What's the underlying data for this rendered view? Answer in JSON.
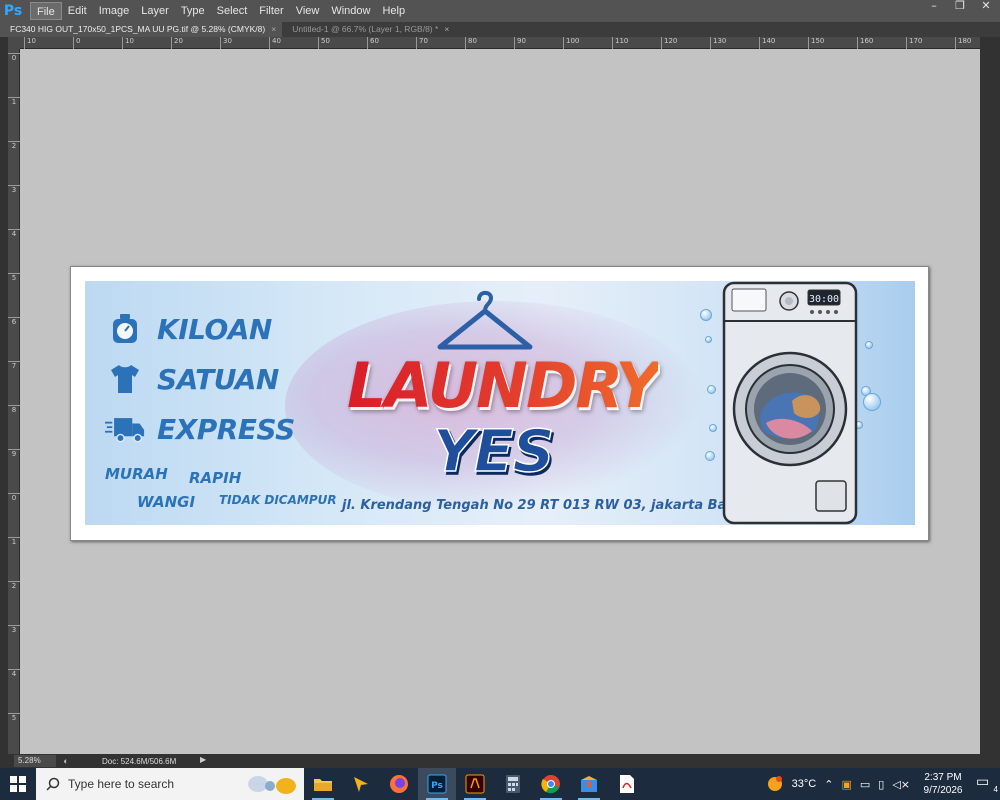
{
  "app": {
    "logo": "Ps"
  },
  "menu": [
    "File",
    "Edit",
    "Image",
    "Layer",
    "Type",
    "Select",
    "Filter",
    "View",
    "Window",
    "Help"
  ],
  "window_controls": [
    "–",
    "❐",
    "✕"
  ],
  "tabs": [
    {
      "label": "FC340 HIG OUT_170x50_1PCS_MA UU PG.tif @ 5.28% (CMYK/8)",
      "close": "×"
    },
    {
      "label": "Untitled-1 @ 66.7% (Layer 1, RGB/8) *",
      "close": "×"
    }
  ],
  "ruler_h": [
    "10",
    "0",
    "10",
    "20",
    "30",
    "40",
    "50",
    "60",
    "70",
    "80",
    "90",
    "100",
    "110",
    "120",
    "130",
    "140",
    "150",
    "160",
    "170",
    "180"
  ],
  "ruler_v": [
    "0",
    "1",
    "2",
    "3",
    "4",
    "5",
    "6",
    "7",
    "8",
    "9",
    "0",
    "1",
    "2",
    "3",
    "4",
    "5"
  ],
  "banner": {
    "services": [
      "KILOAN",
      "SATUAN",
      "EXPRESS"
    ],
    "tags": [
      "MURAH",
      "RAPIH",
      "WANGI",
      "TIDAK DICAMPUR"
    ],
    "title_line1": "LAUNDRY",
    "title_line2": "YES",
    "address": "jl. Krendang Tengah No 29 RT 013 RW 03, jakarta Barat",
    "washer_display": "30:00",
    "colors": {
      "title_red": "#d81e2a",
      "title_orange": "#ef6b2c",
      "title_blue": "#1f4e9a",
      "service_blue": "#2c72b8"
    }
  },
  "status": {
    "zoom": "5.28%",
    "doc": "Doc: 524.6M/506.6M",
    "arrow": "▶"
  },
  "taskbar": {
    "search_placeholder": "Type here to search",
    "apps": [
      "file-explorer",
      "app-arrow",
      "firefox",
      "photoshop",
      "illustrator",
      "calculator",
      "chrome",
      "app-box",
      "pdf"
    ],
    "weather": "33°C",
    "time": "2:37 PM",
    "date": "9/7/2026",
    "notifications": "4"
  }
}
